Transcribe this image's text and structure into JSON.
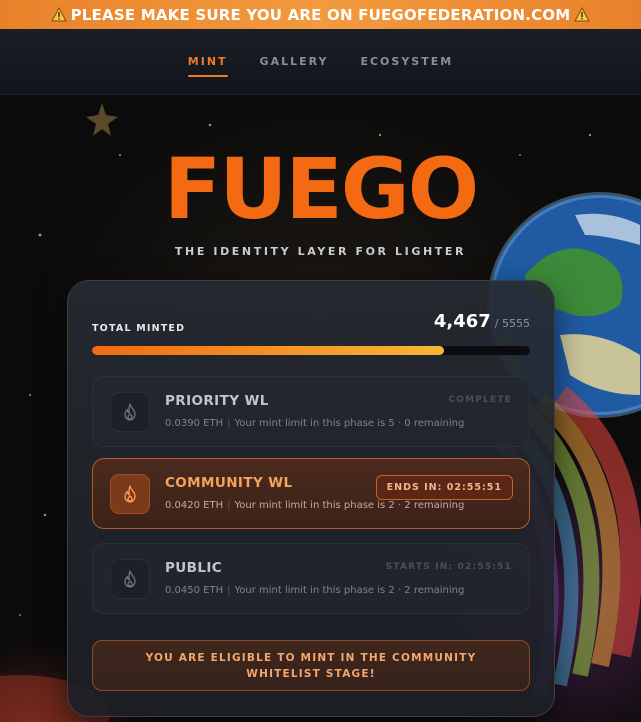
{
  "banner": {
    "text": "PLEASE MAKE SURE YOU ARE ON FUEGOFEDERATION.COM",
    "icon": "warning-icon",
    "color": "#f0913a"
  },
  "nav": {
    "tabs": [
      {
        "label": "MINT",
        "active": true
      },
      {
        "label": "GALLERY",
        "active": false
      },
      {
        "label": "ECOSYSTEM",
        "active": false
      }
    ]
  },
  "hero": {
    "logo": "FUEGO",
    "tagline": "THE IDENTITY LAYER FOR LIGHTER",
    "accent_color": "#f36a12"
  },
  "mint": {
    "total_label": "TOTAL MINTED",
    "minted": "4,467",
    "supply": "/ 5555",
    "progress_fraction": 0.804
  },
  "phases": [
    {
      "name": "PRIORITY WL",
      "price": "0.0390 ETH",
      "limit_text": "Your mint limit in this phase is 5 · 0 remaining",
      "status": "COMPLETE",
      "icon": "flame-icon",
      "state": "complete"
    },
    {
      "name": "COMMUNITY WL",
      "price": "0.0420 ETH",
      "limit_text": "Your mint limit in this phase is 2 · 2 remaining",
      "status": "ENDS IN: 02:55:51",
      "icon": "flame-icon",
      "state": "active"
    },
    {
      "name": "PUBLIC",
      "price": "0.0450 ETH",
      "limit_text": "Your mint limit in this phase is 2 · 2 remaining",
      "status": "STARTS IN: 02:55:51",
      "icon": "flame-icon",
      "state": "upcoming"
    }
  ],
  "eligibility": {
    "message": "YOU ARE ELIGIBLE TO MINT IN THE COMMUNITY WHITELIST STAGE!"
  }
}
